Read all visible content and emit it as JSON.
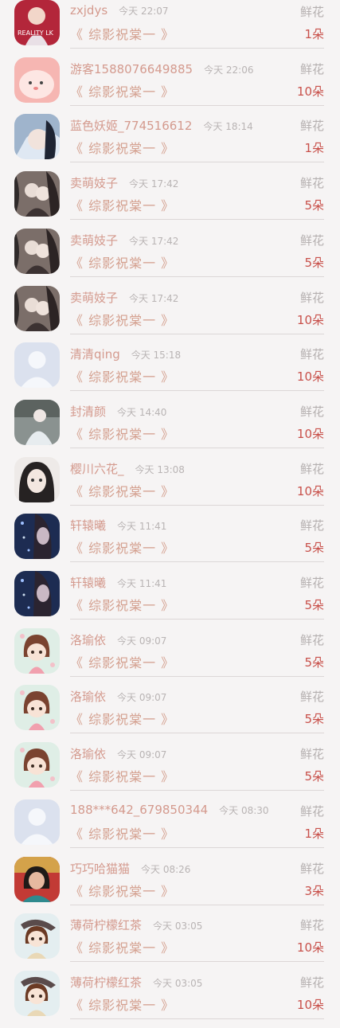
{
  "gifts": [
    {
      "user": "zxjdys",
      "time": "今天 22:07",
      "kind": "鲜花",
      "work": "《 综影祝棠一 》",
      "count": "1朵",
      "avatar": "reality-doll"
    },
    {
      "user": "游客1588076649885",
      "time": "今天 22:06",
      "kind": "鲜花",
      "work": "《 综影祝棠一 》",
      "count": "10朵",
      "avatar": "pink-blob"
    },
    {
      "user": "蓝色妖姬_774516612",
      "time": "今天 18:14",
      "kind": "鲜花",
      "work": "《 综影祝棠一 》",
      "count": "1朵",
      "avatar": "blue-girl"
    },
    {
      "user": "卖萌妓子",
      "time": "今天 17:42",
      "kind": "鲜花",
      "work": "《 综影祝棠一 》",
      "count": "5朵",
      "avatar": "couple"
    },
    {
      "user": "卖萌妓子",
      "time": "今天 17:42",
      "kind": "鲜花",
      "work": "《 综影祝棠一 》",
      "count": "5朵",
      "avatar": "couple"
    },
    {
      "user": "卖萌妓子",
      "time": "今天 17:42",
      "kind": "鲜花",
      "work": "《 综影祝棠一 》",
      "count": "10朵",
      "avatar": "couple"
    },
    {
      "user": "清清qing",
      "time": "今天 15:18",
      "kind": "鲜花",
      "work": "《 综影祝棠一 》",
      "count": "10朵",
      "avatar": "default"
    },
    {
      "user": "封清颜",
      "time": "今天 14:40",
      "kind": "鲜花",
      "work": "《 综影祝棠一 》",
      "count": "10朵",
      "avatar": "white-robe"
    },
    {
      "user": "樱川六花_",
      "time": "今天 13:08",
      "kind": "鲜花",
      "work": "《 综影祝棠一 》",
      "count": "10朵",
      "avatar": "anime-girl"
    },
    {
      "user": "轩辕曦",
      "time": "今天 11:41",
      "kind": "鲜花",
      "work": "《 综影祝棠一 》",
      "count": "5朵",
      "avatar": "dark-blue"
    },
    {
      "user": "轩辕曦",
      "time": "今天 11:41",
      "kind": "鲜花",
      "work": "《 综影祝棠一 》",
      "count": "5朵",
      "avatar": "dark-blue"
    },
    {
      "user": "洛瑜依",
      "time": "今天 09:07",
      "kind": "鲜花",
      "work": "《 综影祝棠一 》",
      "count": "5朵",
      "avatar": "chibi-girl"
    },
    {
      "user": "洛瑜依",
      "time": "今天 09:07",
      "kind": "鲜花",
      "work": "《 综影祝棠一 》",
      "count": "5朵",
      "avatar": "chibi-girl"
    },
    {
      "user": "洛瑜依",
      "time": "今天 09:07",
      "kind": "鲜花",
      "work": "《 综影祝棠一 》",
      "count": "5朵",
      "avatar": "chibi-girl"
    },
    {
      "user": "188***642_679850344",
      "time": "今天 08:30",
      "kind": "鲜花",
      "work": "《 综影祝棠一 》",
      "count": "1朵",
      "avatar": "default"
    },
    {
      "user": "巧巧哈猫猫",
      "time": "今天 08:26",
      "kind": "鲜花",
      "work": "《 综影祝棠一 》",
      "count": "3朵",
      "avatar": "photo-woman"
    },
    {
      "user": "薄荷柠檬红茶",
      "time": "今天 03:05",
      "kind": "鲜花",
      "work": "《 综影祝棠一 》",
      "count": "10朵",
      "avatar": "chibi-cap"
    },
    {
      "user": "薄荷柠檬红茶",
      "time": "今天 03:05",
      "kind": "鲜花",
      "work": "《 综影祝棠一 》",
      "count": "10朵",
      "avatar": "chibi-cap"
    }
  ]
}
